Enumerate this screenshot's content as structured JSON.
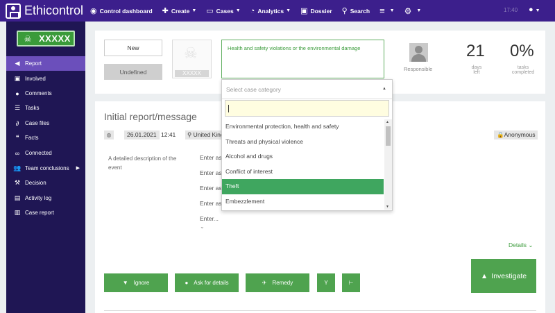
{
  "nav": {
    "logo": "Ethicontrol",
    "items": [
      {
        "label": "Control dashboard",
        "icon": "dashboard-icon",
        "caret": false
      },
      {
        "label": "Create",
        "icon": "plus-icon",
        "caret": true
      },
      {
        "label": "Cases",
        "icon": "folder-icon",
        "caret": true
      },
      {
        "label": "Analytics",
        "icon": "pie-chart-icon",
        "caret": true
      },
      {
        "label": "Dossier",
        "icon": "id-card-icon",
        "caret": false
      },
      {
        "label": "Search",
        "icon": "search-icon",
        "caret": false
      }
    ],
    "time": "17:40"
  },
  "sidebar": {
    "badge": "XXXXX",
    "items": [
      {
        "label": "Report",
        "icon": "megaphone-icon",
        "active": true
      },
      {
        "label": "Involved",
        "icon": "id-card-icon"
      },
      {
        "label": "Comments",
        "icon": "comments-icon"
      },
      {
        "label": "Tasks",
        "icon": "list-icon"
      },
      {
        "label": "Case files",
        "icon": "paperclip-icon"
      },
      {
        "label": "Facts",
        "icon": "quote-icon"
      },
      {
        "label": "Connected",
        "icon": "link-icon"
      },
      {
        "label": "Team conclusions",
        "icon": "users-icon",
        "arrow": true
      },
      {
        "label": "Decision",
        "icon": "gavel-icon"
      },
      {
        "label": "Activity log",
        "icon": "book-icon"
      },
      {
        "label": "Case report",
        "icon": "report-icon"
      }
    ]
  },
  "header": {
    "status": "New",
    "priority": "Undefined",
    "avatar_label": "XXXXX",
    "summary": "Health and safety violations or the environmental damage",
    "responsible_label": "Responsible",
    "days_left": "21",
    "days_left_label": [
      "days",
      "left"
    ],
    "tasks_completed": "0%",
    "tasks_completed_label": [
      "tasks",
      "completed"
    ]
  },
  "report": {
    "title": "Initial report/message",
    "date": "26.01.2021",
    "time": "12:41",
    "country": "United Kingdom",
    "anonymous": "Anonymous",
    "description_label": "A detailed description of the event",
    "enter_lines": [
      "Enter as",
      "Enter as",
      "Enter as",
      "Enter as",
      "Enter..."
    ],
    "details_link": "Details"
  },
  "actions": {
    "ignore": "Ignore",
    "ask": "Ask for details",
    "remedy": "Remedy",
    "investigate": "Investigate"
  },
  "dropdown": {
    "placeholder": "Select case category",
    "options": [
      "Environmental protection, health and safety",
      "Threats and physical violence",
      "Alcohol and drugs",
      "Conflict of interest",
      "Theft",
      "Embezzlement"
    ],
    "selected_index": 4
  },
  "colors": {
    "nav": "#3c1f8c",
    "sidebar": "#1f1654",
    "active": "#6b4fbb",
    "accent_green": "#4fa34f"
  }
}
